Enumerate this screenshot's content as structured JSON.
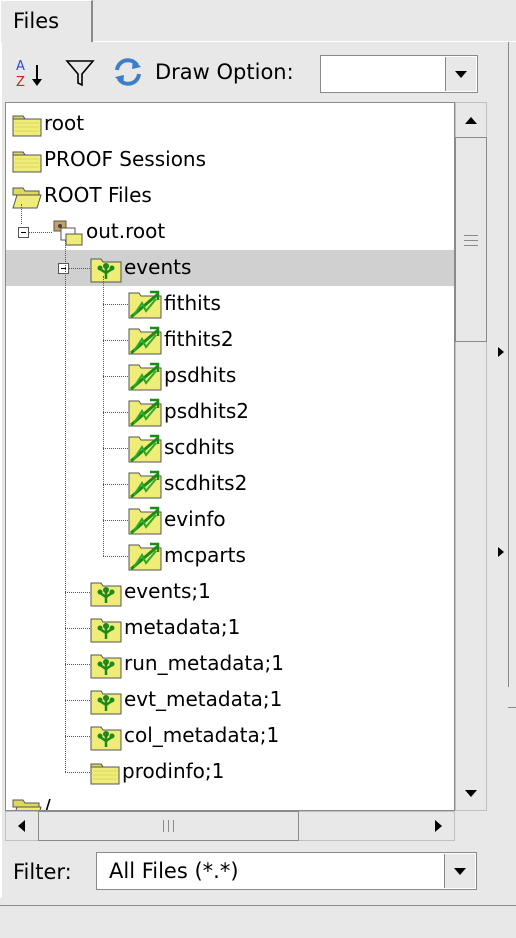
{
  "tab": {
    "label": "Files"
  },
  "toolbar": {
    "sort_icon": "sort-az-icon",
    "filter_icon": "funnel-icon",
    "refresh_icon": "refresh-icon",
    "draw_option_label": "Draw Option:",
    "draw_option_value": ""
  },
  "tree": {
    "items": [
      {
        "label": "root",
        "icon": "folder-icon",
        "level": 0
      },
      {
        "label": "PROOF Sessions",
        "icon": "folder-icon",
        "level": 0
      },
      {
        "label": "ROOT Files",
        "icon": "folder-open-icon",
        "level": 0
      },
      {
        "label": "out.root",
        "icon": "root-file-icon",
        "level": 1,
        "expanded": true
      },
      {
        "label": "events",
        "icon": "tree-icon",
        "level": 2,
        "expanded": true,
        "selected": true
      },
      {
        "label": "fithits",
        "icon": "branch-leaf-icon",
        "level": 3
      },
      {
        "label": "fithits2",
        "icon": "branch-leaf-icon",
        "level": 3
      },
      {
        "label": "psdhits",
        "icon": "branch-leaf-icon",
        "level": 3
      },
      {
        "label": "psdhits2",
        "icon": "branch-leaf-icon",
        "level": 3
      },
      {
        "label": "scdhits",
        "icon": "branch-leaf-icon",
        "level": 3
      },
      {
        "label": "scdhits2",
        "icon": "branch-leaf-icon",
        "level": 3
      },
      {
        "label": "evinfo",
        "icon": "branch-leaf-icon",
        "level": 3
      },
      {
        "label": "mcparts",
        "icon": "branch-leaf-icon",
        "level": 3
      },
      {
        "label": "events;1",
        "icon": "tree-icon",
        "level": 2
      },
      {
        "label": "metadata;1",
        "icon": "tree-icon",
        "level": 2
      },
      {
        "label": "run_metadata;1",
        "icon": "tree-icon",
        "level": 2
      },
      {
        "label": "evt_metadata;1",
        "icon": "tree-icon",
        "level": 2
      },
      {
        "label": "col_metadata;1",
        "icon": "tree-icon",
        "level": 2
      },
      {
        "label": "prodinfo;1",
        "icon": "folder-icon",
        "level": 2
      },
      {
        "label": "/",
        "icon": "folder-open-icon",
        "level": 0
      }
    ]
  },
  "filter": {
    "label": "Filter:",
    "value": "All Files (*.*)"
  },
  "colors": {
    "selection": "#d0d0d0",
    "folder_yellow": "#f0ec78",
    "tree_green": "#1a8a1a",
    "refresh_blue": "#3a7fc8"
  }
}
